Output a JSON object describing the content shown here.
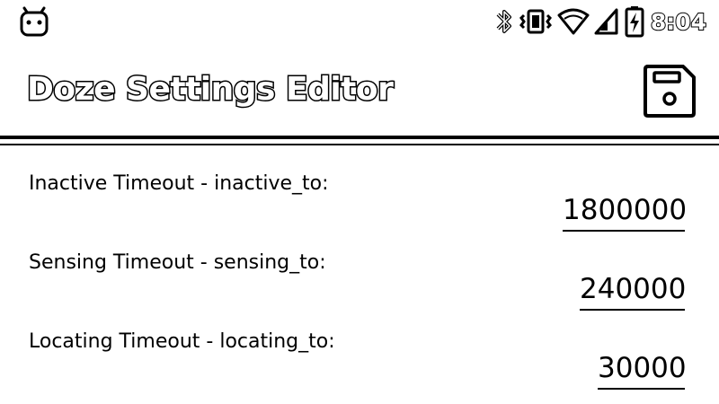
{
  "status_bar": {
    "time": "8:04",
    "left_icon": "android-icon",
    "icons": [
      "bluetooth-icon",
      "vibrate-icon",
      "wifi-icon",
      "signal-icon",
      "battery-charging-icon"
    ]
  },
  "app_bar": {
    "title": "Doze Settings Editor",
    "save_icon": "floppy-disk-icon"
  },
  "settings": [
    {
      "label": "Inactive Timeout - inactive_to:",
      "value": "1800000"
    },
    {
      "label": "Sensing Timeout - sensing_to:",
      "value": "240000"
    },
    {
      "label": "Locating Timeout - locating_to:",
      "value": "30000"
    }
  ]
}
